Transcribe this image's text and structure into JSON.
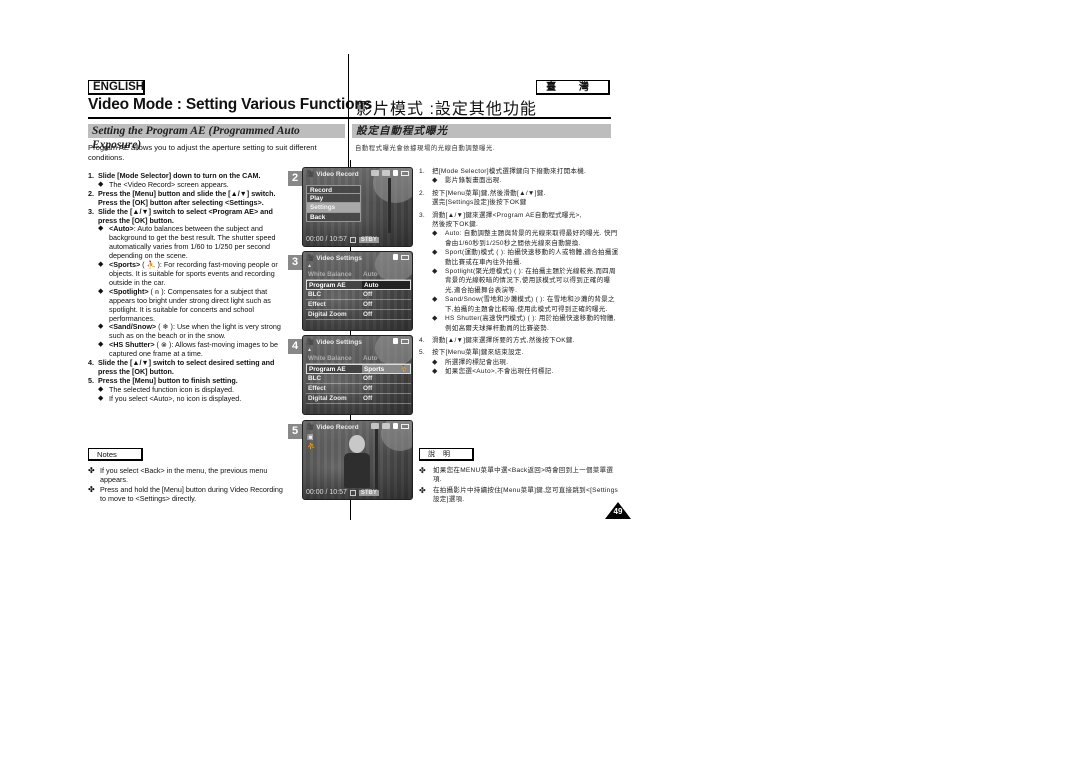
{
  "header": {
    "lang_en": "ENGLISH",
    "lang_tw": "臺 灣",
    "title_en": "Video Mode : Setting Various Functions",
    "title_zh": "影片模式 :設定其他功能"
  },
  "section": {
    "title_en": "Setting the Program AE (Programmed Auto Exposure)",
    "title_zh": "設定自動程式曝光",
    "intro_en": "Program AE allows you to adjust the aperture setting to suit different conditions.",
    "intro_zh": "自動程式曝光會依據現場的光線自動調整曝光."
  },
  "steps_en": [
    {
      "num": "1.",
      "text": "Slide [Mode Selector] down to turn on the CAM.",
      "bullets": [
        {
          "label": "",
          "text": "The <Video Record> screen appears."
        }
      ]
    },
    {
      "num": "2.",
      "text": "Press the [Menu] button and slide the [▲/▼] switch.",
      "text2": "Press the [OK] button after selecting <Settings>.",
      "bullets": []
    },
    {
      "num": "3.",
      "text": "Slide the [▲/▼] switch to select <Program AE> and press the [OK] button.",
      "bullets": [
        {
          "label": "<Auto>",
          "text": ": Auto balances between the subject and background to get the best result. The shutter speed automatically varies from 1/60 to 1/250 per second depending on the scene."
        },
        {
          "label": "<Sports>",
          "icon": "sports-icon",
          "text": ": For recording fast-moving people or objects. It is suitable for sports events and recording outside in the car."
        },
        {
          "label": "<Spotlight>",
          "icon": "spotlight-icon",
          "text": ": Compensates for a subject that appears too bright under strong direct light such as spotlight. It is suitable for concerts and school performances."
        },
        {
          "label": "<Sand/Snow>",
          "icon": "sand-snow-icon",
          "text": ": Use when the light is very strong such as on the beach or in the snow."
        },
        {
          "label": "<HS Shutter>",
          "icon": "hs-shutter-icon",
          "text": ": Allows fast-moving images to be captured one frame at a time."
        }
      ]
    },
    {
      "num": "4.",
      "text": "Slide the [▲/▼] switch to select desired setting and press the [OK] button.",
      "bullets": []
    },
    {
      "num": "5.",
      "text": "Press the [Menu] button to finish setting.",
      "bullets": [
        {
          "label": "",
          "text": "The selected function icon is displayed."
        },
        {
          "label": "",
          "text": "If you select <Auto>, no icon is displayed."
        }
      ]
    }
  ],
  "notes_en": {
    "label": "Notes",
    "items": [
      "If you select <Back> in the menu, the previous menu appears.",
      "Press and hold the [Menu] button during Video Recording to move to <Settings> directly."
    ]
  },
  "screens": [
    {
      "num": "2",
      "title": "Video Record",
      "menu": [
        "Record",
        "Play",
        "Settings",
        "Back"
      ],
      "selected": "Settings",
      "timecode": "00:00 / 10:57",
      "status": "STBY"
    },
    {
      "num": "3",
      "title": "Video Settings",
      "rows": [
        {
          "key": "White Balance",
          "value": "Auto"
        },
        {
          "key": "Program AE",
          "value": "Auto"
        },
        {
          "key": "BLC",
          "value": "Off"
        },
        {
          "key": "Effect",
          "value": "Off"
        },
        {
          "key": "Digital Zoom",
          "value": "Off"
        }
      ]
    },
    {
      "num": "4",
      "title": "Video Settings",
      "rows": [
        {
          "key": "White Balance",
          "value": "Auto"
        },
        {
          "key": "Program AE",
          "value": "Sports"
        },
        {
          "key": "BLC",
          "value": "Off"
        },
        {
          "key": "Effect",
          "value": "Off"
        },
        {
          "key": "Digital Zoom",
          "value": "Off"
        }
      ]
    },
    {
      "num": "5",
      "title": "Video Record",
      "timecode": "00:00 / 10:57",
      "status": "STBY"
    }
  ],
  "steps_zh": [
    {
      "num": "1.",
      "text": "把[Mode Selector]模式選擇鍵向下撥動來打開本機.",
      "bullets": [
        "影片錄製畫面出現."
      ]
    },
    {
      "num": "2.",
      "text": "按下[Menu菜單]鍵,然後滑動[▲/▼]鍵.",
      "text2": "選完[Settings設定]後按下OK鍵",
      "bullets": []
    },
    {
      "num": "3.",
      "text": "滑動[▲/▼]鍵來選擇<Program AE自動程式曝光>,",
      "text2": "然後按下OK鍵.",
      "bullets": [
        "Auto: 自動調整主題與背景的光線來取得最好的曝光. 快門會由1/60秒到1/250秒之間依光線來自動變換.",
        "Sport(運動)模式 (  ): 拍攝快速移動的人或物體,適合拍攝運動比賽或在車內往外拍攝.",
        "Spotlight(聚光燈模式) (  ): 在拍攝主題於光線較亮,而四周背景的光線較暗的情況下,使用該模式可以得到正確的曝光,適合拍攝舞台表演等.",
        "Sand/Snow(雪地和沙灘模式) (  ): 在雪地和沙灘的背景之下,拍攝的主題會比較暗,使用此模式可得到正確的曝光.",
        "HS Shutter(高速快門模式) (  ): 用於拍攝快速移動的物體,例如高爾夫球揮杆動員的比賽姿勢."
      ]
    },
    {
      "num": "4.",
      "text": "滑動[▲/▼]鍵來選擇所要的方式,然後按下OK鍵.",
      "bullets": []
    },
    {
      "num": "5.",
      "text": "按下[Menu菜單]鍵來結束設定.",
      "bullets": [
        "所選擇的標記會出現.",
        "如果您選<Auto>,不會出現任何標記."
      ]
    }
  ],
  "notes_zh": {
    "label": "說明",
    "items": [
      "如果您在MENU菜單中選<Back返回>時會回到上一個菜單選項.",
      "在拍攝影片中持續按住[Menu菜單]鍵,您可直接跳到<[Settings設定]選項."
    ]
  },
  "page_number": "49",
  "colors": {
    "section_bar": "#bdbdbd",
    "menu_selected": "#a8a8a8",
    "text": "#111111"
  }
}
